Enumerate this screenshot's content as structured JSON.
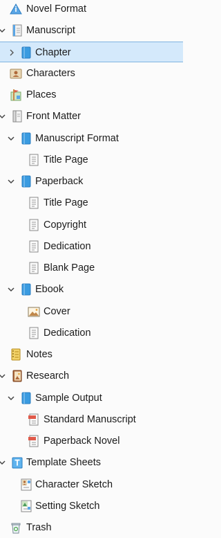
{
  "binder": {
    "items": [
      {
        "label": "Novel Format",
        "icon": "info-triangle-icon"
      },
      {
        "label": "Manuscript",
        "icon": "manuscript-icon"
      },
      {
        "label": "Chapter",
        "icon": "folder-icon"
      },
      {
        "label": "Characters",
        "icon": "character-card-icon"
      },
      {
        "label": "Places",
        "icon": "places-icon"
      },
      {
        "label": "Front Matter",
        "icon": "front-matter-icon"
      },
      {
        "label": "Manuscript Format",
        "icon": "folder-icon"
      },
      {
        "label": "Title Page",
        "icon": "document-icon"
      },
      {
        "label": "Paperback",
        "icon": "folder-icon"
      },
      {
        "label": "Title Page",
        "icon": "document-icon"
      },
      {
        "label": "Copyright",
        "icon": "document-icon"
      },
      {
        "label": "Dedication",
        "icon": "document-icon"
      },
      {
        "label": "Blank Page",
        "icon": "document-icon"
      },
      {
        "label": "Ebook",
        "icon": "folder-icon"
      },
      {
        "label": "Cover",
        "icon": "image-icon"
      },
      {
        "label": "Dedication",
        "icon": "document-icon"
      },
      {
        "label": "Notes",
        "icon": "notepad-icon"
      },
      {
        "label": "Research",
        "icon": "research-icon"
      },
      {
        "label": "Sample Output",
        "icon": "folder-icon"
      },
      {
        "label": "Standard Manuscript",
        "icon": "pdf-icon"
      },
      {
        "label": "Paperback Novel",
        "icon": "pdf-icon"
      },
      {
        "label": "Template Sheets",
        "icon": "template-icon"
      },
      {
        "label": "Character Sketch",
        "icon": "character-sheet-icon"
      },
      {
        "label": "Setting Sketch",
        "icon": "setting-sheet-icon"
      },
      {
        "label": "Trash",
        "icon": "trash-icon"
      }
    ]
  },
  "colors": {
    "selection_bg": "#d4e9fb",
    "selection_border": "#7fb3e0",
    "folder_blue": "#3a9be0"
  }
}
